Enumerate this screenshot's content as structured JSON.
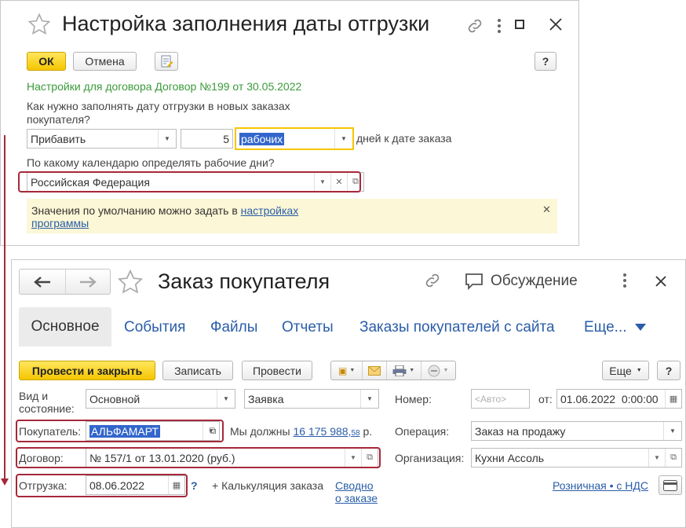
{
  "settings_window": {
    "title": "Настройка заполнения даты отгрузки",
    "ok_label": "ОК",
    "cancel_label": "Отмена",
    "help_label": "?",
    "contract_info": "Настройки для договора Договор №199 от 30.05.2022",
    "question_fill": "Как нужно заполнять дату отгрузки в новых заказах покупателя?",
    "mode_value": "Прибавить",
    "days_value": "5",
    "days_type_value": "рабочих",
    "days_suffix": "дней к дате заказа",
    "question_calendar": "По какому календарю определять рабочие дни?",
    "calendar_value": "Российская Федерация",
    "hint_text": "Значения по умолчанию можно задать в ",
    "hint_link": "настройках программы"
  },
  "order_window": {
    "title": "Заказ покупателя",
    "discussion_label": "Обсуждение",
    "tabs": [
      "Основное",
      "События",
      "Файлы",
      "Отчеты",
      "Заказы покупателей с сайта",
      "Еще..."
    ],
    "post_close_label": "Провести и закрыть",
    "save_label": "Записать",
    "post_label": "Провести",
    "more_label": "Еще",
    "help_label": "?",
    "kind_label": "Вид и состояние:",
    "kind_value": "Основной",
    "state_value": "Заявка",
    "number_label": "Номер:",
    "number_placeholder": "<Авто>",
    "from_label": "от:",
    "date_value": "01.06.2022  0:00:00",
    "buyer_label": "Покупатель:",
    "buyer_value": "АЛЬФАМАРТ",
    "debt_label": "Мы должны",
    "debt_value": "16 175 988,",
    "debt_cents": "58",
    "debt_currency": "р.",
    "operation_label": "Операция:",
    "operation_value": "Заказ на продажу",
    "contract_label": "Договор:",
    "contract_value": "№ 157/1 от 13.01.2020 (руб.)",
    "org_label": "Организация:",
    "org_value": "Кухни Ассоль",
    "shipment_label": "Отгрузка:",
    "shipment_value": "08.06.2022",
    "shipment_help": "?",
    "calc_label": "+ Калькуляция заказа",
    "summary_link": "Сводно о заказе",
    "retail_link": "Розничная • с НДС"
  },
  "colors": {
    "accent_yellow": "#f5c600",
    "highlight_red": "#a6283a",
    "link_blue": "#2a5da8",
    "info_green": "#3a9a3a",
    "hint_bg": "#fcf7d6"
  }
}
